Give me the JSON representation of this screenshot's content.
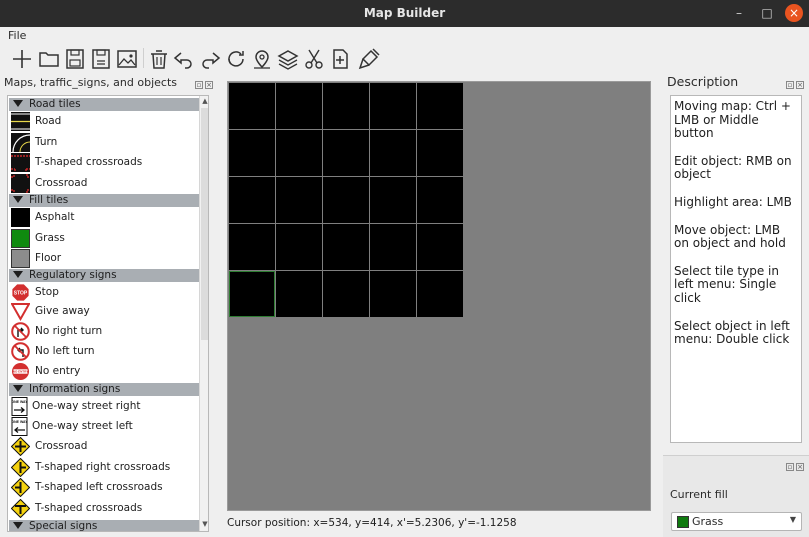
{
  "window": {
    "title": "Map Builder",
    "minimize": "–",
    "maximize": "□",
    "close": "×"
  },
  "menu": {
    "file": "File"
  },
  "toolbar": [
    "new-icon",
    "open-folder-icon",
    "save-icon",
    "save-as-icon",
    "export-image-icon",
    "delete-icon",
    "undo-icon",
    "redo-icon",
    "rotate-icon",
    "place-marker-icon",
    "layers-icon",
    "cut-icon",
    "insert-icon",
    "brush-icon"
  ],
  "left_dock": {
    "title": "Maps, traffic_signs, and objects",
    "categories": [
      {
        "label": "Road tiles",
        "items": [
          "Road",
          "Turn",
          "T-shaped crossroads",
          "Crossroad"
        ]
      },
      {
        "label": "Fill tiles",
        "items": [
          "Asphalt",
          "Grass",
          "Floor"
        ]
      },
      {
        "label": "Regulatory signs",
        "items": [
          "Stop",
          "Give away",
          "No right turn",
          "No left turn",
          "No entry"
        ]
      },
      {
        "label": "Information signs",
        "items": [
          "One-way street right",
          "One-way street left",
          "Crossroad",
          "T-shaped right crossroads",
          "T-shaped left crossroads",
          "T-shaped crossroads"
        ]
      },
      {
        "label": "Special signs",
        "items": []
      }
    ],
    "icon_text": {
      "stop": "STOP",
      "no_entry": "NO ENTRY",
      "one_way": "ONE WAY"
    }
  },
  "map": {
    "background": "#7f7f7f",
    "tile_color": "#000000",
    "highlight_color": "#2e7d32",
    "columns": 5,
    "rows": 5,
    "highlighted_cell": {
      "row": 5,
      "column": 1
    }
  },
  "status": {
    "cursor": "Cursor position: x=534, y=414, x'=5.2306, y'=-1.1258"
  },
  "description": {
    "title": "Description",
    "lines": [
      "Moving map: Ctrl + LMB or Middle button",
      "Edit object: RMB on object",
      "Highlight area: LMB",
      "Move object: LMB on object and hold",
      "Select tile type in left menu: Single click",
      "Select object in left menu: Double click"
    ]
  },
  "current_fill": {
    "label": "Current fill",
    "value": "Grass",
    "color": "#0f7a0f"
  },
  "colors": {
    "accent_close": "#e95420",
    "category_bg": "#a9aeb3",
    "titlebar": "#2c2c2c"
  }
}
